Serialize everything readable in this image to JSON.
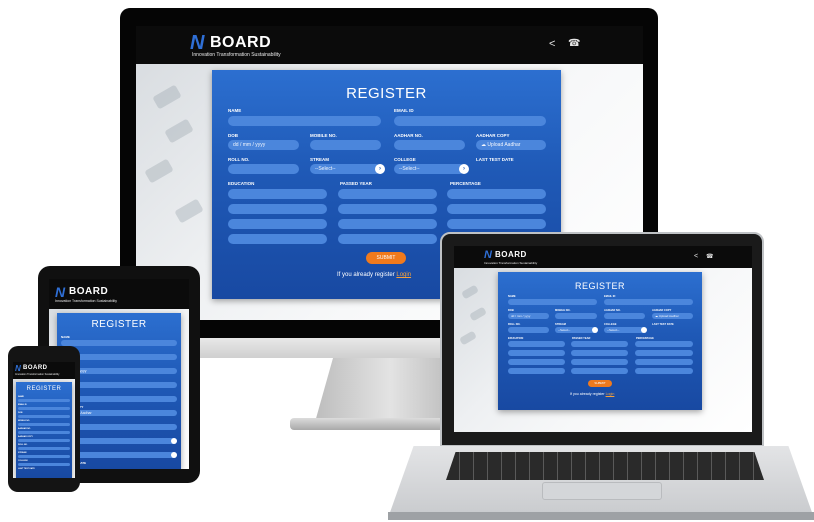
{
  "brand": {
    "logo_text": "BOARD",
    "tagline": "Innovation  Transformation  Sustainability",
    "accent_blue": "#1f59b6",
    "submit_orange": "#f07a1d"
  },
  "header_icons": [
    "share-icon",
    "phone-icon"
  ],
  "register_form": {
    "title": "REGISTER",
    "labels": {
      "name": "NAME",
      "email": "EMAIL ID",
      "dob": "DOB",
      "mobile": "MOBILE NO.",
      "aadhar_no": "AADHAR NO.",
      "aadhar_copy": "AADHAR COPY",
      "roll_no": "ROLL NO.",
      "stream": "STREAM",
      "college": "COLLEGE",
      "last_test_date": "LAST TEST DATE",
      "education": "EDUCATION",
      "passed_year": "PASSED YEAR",
      "percentage": "PERCENTAGE"
    },
    "dob_placeholder": "dd / mm / yyyy",
    "upload_label": "Upload Aadhar",
    "select_placeholder": "--Select--",
    "submit_label": "SUBMIT",
    "login_prompt": "If you already register",
    "login_link": "Login"
  }
}
